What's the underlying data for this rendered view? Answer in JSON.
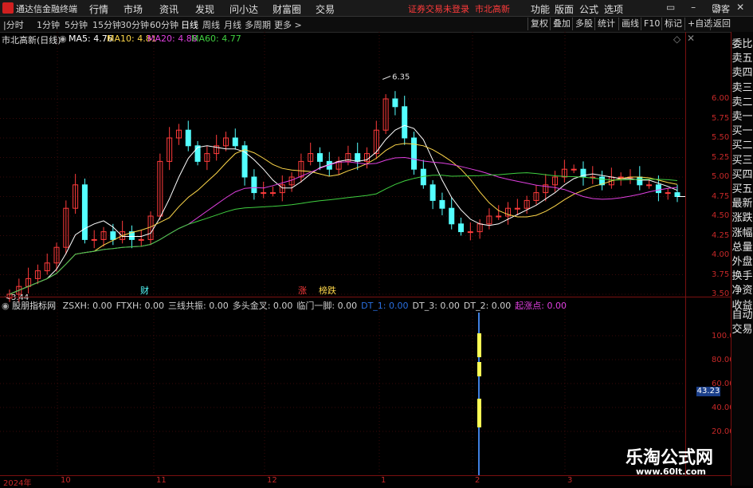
{
  "app": {
    "name": "通达信金融终端"
  },
  "menu": [
    "行情",
    "市场",
    "资讯",
    "发现",
    "问小达",
    "财富圈",
    "交易"
  ],
  "menu_right": [
    "功能",
    "版面",
    "公式",
    "选项"
  ],
  "login_warning": "证券交易未登录",
  "login_warning_2": "市北高新",
  "guest": "游客",
  "periods": [
    "分时",
    "1分钟",
    "5分钟",
    "15分钟",
    "30分钟",
    "60分钟",
    "日线",
    "周线",
    "月线",
    "多周期",
    "更多 >"
  ],
  "active_period": "日线",
  "toolbar_right": [
    "复权",
    "叠加",
    "多股",
    "统计",
    "画线",
    "F10",
    "标记",
    "+自选",
    "返回"
  ],
  "main_chart": {
    "title": "市北高新(日线)",
    "ma": [
      {
        "label": "MA5: 4.76",
        "color": "#ffffff"
      },
      {
        "label": "MA10: 4.81",
        "color": "#ffd84a"
      },
      {
        "label": "MA20: 4.88",
        "color": "#e040e0"
      },
      {
        "label": "MA60: 4.77",
        "color": "#40d040"
      }
    ],
    "high_label": "6.35",
    "low_label": "3.44",
    "markers": [
      "财",
      "涨",
      "榜跌"
    ],
    "y_ticks": [
      "6.00",
      "5.75",
      "5.50",
      "5.25",
      "5.00",
      "4.75",
      "4.50",
      "4.25",
      "4.00",
      "3.75",
      "3.50"
    ]
  },
  "right_panel": [
    "委比",
    "卖五",
    "卖四",
    "卖三",
    "卖二",
    "卖一",
    "买一",
    "买二",
    "买三",
    "买四",
    "买五",
    "最新",
    "涨跌",
    "涨幅",
    "总量",
    "外盘",
    "换手",
    "净资",
    "收益",
    "自动",
    "交易"
  ],
  "indicator": {
    "name": "股朋指标网",
    "items": [
      {
        "label": "ZSXH: 0.00",
        "color": "#d0d0d0"
      },
      {
        "label": "FTXH: 0.00",
        "color": "#d0d0d0"
      },
      {
        "label": "三线共振: 0.00",
        "color": "#d0d0d0"
      },
      {
        "label": "多头金叉: 0.00",
        "color": "#d0d0d0"
      },
      {
        "label": "临门一脚: 0.00",
        "color": "#d0d0d0"
      },
      {
        "label": "DT_1: 0.00",
        "color": "#2a6fe0"
      },
      {
        "label": "DT_3: 0.00",
        "color": "#d0d0d0"
      },
      {
        "label": "DT_2: 0.00",
        "color": "#d0d0d0"
      },
      {
        "label": "起涨点: 0.00",
        "color": "#e040e0"
      }
    ],
    "y_ticks": [
      "100.00",
      "80.00",
      "60.00",
      "40.00",
      "20.00"
    ],
    "current_value": "43.23"
  },
  "date_axis": [
    "2024年",
    "10",
    "11",
    "12",
    "1",
    "2",
    "3"
  ],
  "watermark": {
    "title": "乐淘公式网",
    "url": "www.60lt.com"
  },
  "chart_data": {
    "type": "candlestick",
    "title": "市北高新(日线)",
    "ylim": [
      3.4,
      6.4
    ],
    "series": [
      {
        "name": "MA5",
        "last": 4.76
      },
      {
        "name": "MA10",
        "last": 4.81
      },
      {
        "name": "MA20",
        "last": 4.88
      },
      {
        "name": "MA60",
        "last": 4.77
      }
    ],
    "close_approx": [
      3.5,
      3.6,
      3.7,
      3.8,
      3.9,
      4.1,
      4.6,
      4.9,
      4.2,
      4.2,
      4.3,
      4.2,
      4.3,
      4.2,
      4.2,
      4.5,
      5.2,
      5.5,
      5.6,
      5.4,
      5.2,
      5.3,
      5.4,
      5.5,
      5.4,
      5.0,
      4.8,
      4.8,
      4.8,
      4.9,
      5.0,
      5.2,
      5.3,
      5.2,
      5.1,
      5.2,
      5.3,
      5.2,
      5.3,
      5.6,
      6.0,
      5.9,
      5.5,
      5.1,
      4.9,
      4.7,
      4.6,
      4.4,
      4.3,
      4.3,
      4.4,
      4.5,
      4.5,
      4.6,
      4.6,
      4.7,
      4.8,
      4.9,
      5.0,
      5.1,
      5.1,
      5.0,
      5.0,
      4.9,
      5.0,
      5.0,
      5.0,
      4.9,
      4.9,
      4.8,
      4.8,
      4.75
    ]
  }
}
